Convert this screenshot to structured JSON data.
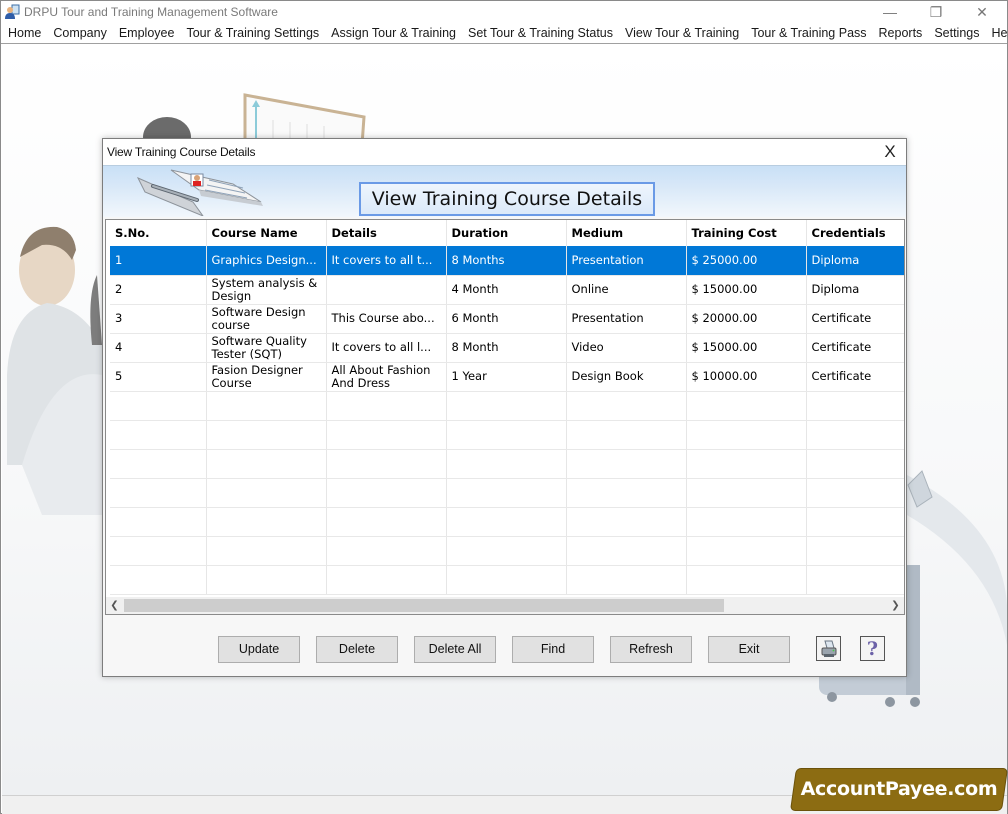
{
  "app": {
    "title": "DRPU Tour and Training Management Software",
    "window_controls": {
      "minimize": "—",
      "maximize": "❐",
      "close": "✕"
    }
  },
  "menubar": {
    "items": [
      {
        "label": "Home"
      },
      {
        "label": "Company"
      },
      {
        "label": "Employee"
      },
      {
        "label": "Tour & Training Settings"
      },
      {
        "label": "Assign Tour & Training"
      },
      {
        "label": "Set Tour & Training Status"
      },
      {
        "label": "View Tour & Training"
      },
      {
        "label": "Tour & Training Pass"
      },
      {
        "label": "Reports"
      },
      {
        "label": "Settings"
      },
      {
        "label": "Help"
      }
    ]
  },
  "dialog": {
    "title": "View Training Course Details",
    "close_glyph": "X",
    "banner_title": "View Training Course Details",
    "grid": {
      "columns": [
        "S.No.",
        "Course Name",
        "Details",
        "Duration",
        "Medium",
        "Training Cost",
        "Credentials"
      ],
      "rows": [
        {
          "sno": "1",
          "course_name": "Graphics Design...",
          "details": "It covers to all t...",
          "duration": "8 Months",
          "medium": "Presentation",
          "cost": "$ 25000.00",
          "credentials": "Diploma",
          "selected": true
        },
        {
          "sno": "2",
          "course_name": "System analysis & Design",
          "details": "",
          "duration": "4 Month",
          "medium": "Online",
          "cost": "$ 15000.00",
          "credentials": "Diploma",
          "selected": false
        },
        {
          "sno": "3",
          "course_name": "Software Design course",
          "details": "This Course abo...",
          "duration": "6 Month",
          "medium": "Presentation",
          "cost": "$ 20000.00",
          "credentials": "Certificate",
          "selected": false
        },
        {
          "sno": "4",
          "course_name": "Software Quality Tester (SQT)",
          "details": "It covers to all l...",
          "duration": "8 Month",
          "medium": "Video",
          "cost": "$ 15000.00",
          "credentials": "Certificate",
          "selected": false
        },
        {
          "sno": "5",
          "course_name": "Fasion Designer Course",
          "details": "All About Fashion And Dress",
          "duration": "1 Year",
          "medium": "Design Book",
          "cost": "$ 10000.00",
          "credentials": "Certificate",
          "selected": false
        }
      ],
      "empty_rows": 7,
      "scroll_left_glyph": "❮",
      "scroll_right_glyph": "❯"
    },
    "buttons": {
      "update": "Update",
      "delete": "Delete",
      "delete_all": "Delete All",
      "find": "Find",
      "refresh": "Refresh",
      "exit": "Exit"
    },
    "icons": {
      "print": "printer-icon",
      "help": "help-icon",
      "help_glyph": "?"
    }
  },
  "watermark": {
    "text": "AccountPayee.com",
    "color": "#8c6c12"
  },
  "colors": {
    "selection": "#0078d7",
    "banner_border": "#6a9ae6"
  }
}
